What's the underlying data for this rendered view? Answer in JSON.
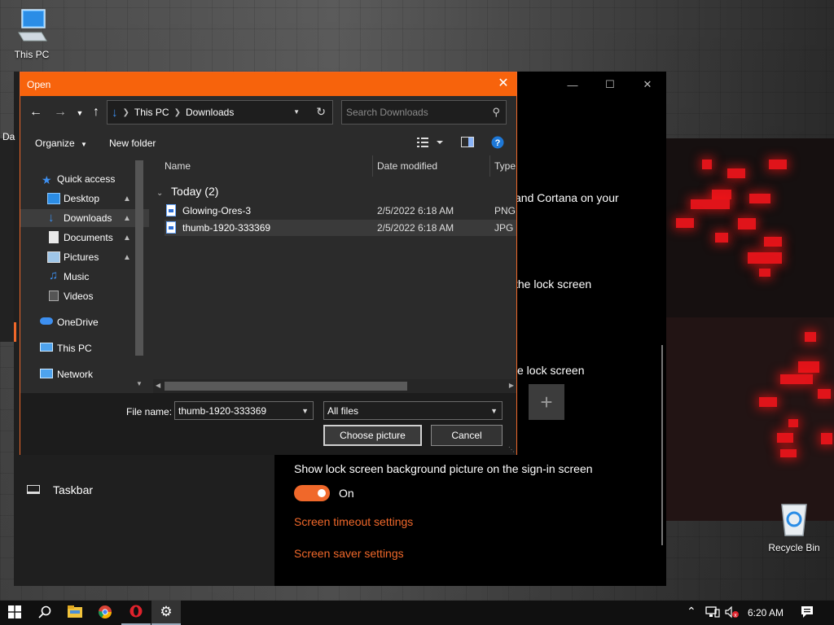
{
  "desktop": {
    "icons": [
      {
        "label": "This PC",
        "icon": "this-pc-icon"
      },
      {
        "label": "Recycle Bin",
        "icon": "recycle-bin-icon"
      }
    ]
  },
  "settings": {
    "left_partial_label": "Da",
    "text_cortana": "and Cortana on your",
    "text_lock_screen_1": "the lock screen",
    "text_lock_screen_2": "e lock screen",
    "add_tile_symbol": "+",
    "taskbar_item": "Taskbar",
    "signin_label": "Show lock screen background picture on the sign-in screen",
    "toggle_state": "On",
    "link_timeout": "Screen timeout settings",
    "link_screensaver": "Screen saver settings",
    "accent_color": "#f0682a"
  },
  "dialog": {
    "title": "Open",
    "address": {
      "root": "This PC",
      "current": "Downloads"
    },
    "search_placeholder": "Search Downloads",
    "toolbar": {
      "organize": "Organize",
      "new_folder": "New folder"
    },
    "nav": [
      {
        "label": "Quick access",
        "icon": "star-icon"
      },
      {
        "label": "Desktop",
        "icon": "desktop-folder-icon",
        "pinned": true
      },
      {
        "label": "Downloads",
        "icon": "downloads-folder-icon",
        "pinned": true,
        "selected": true
      },
      {
        "label": "Documents",
        "icon": "documents-folder-icon",
        "pinned": true
      },
      {
        "label": "Pictures",
        "icon": "pictures-folder-icon",
        "pinned": true
      },
      {
        "label": "Music",
        "icon": "music-folder-icon"
      },
      {
        "label": "Videos",
        "icon": "videos-folder-icon"
      },
      {
        "label": "OneDrive",
        "icon": "onedrive-icon"
      },
      {
        "label": "This PC",
        "icon": "this-pc-icon"
      },
      {
        "label": "Network",
        "icon": "network-icon"
      }
    ],
    "columns": {
      "name": "Name",
      "date": "Date modified",
      "type": "Type"
    },
    "group": "Today (2)",
    "files": [
      {
        "name": "Glowing-Ores-3",
        "date": "2/5/2022 6:18 AM",
        "type": "PNG"
      },
      {
        "name": "thumb-1920-333369",
        "date": "2/5/2022 6:18 AM",
        "type": "JPG F",
        "selected": true
      }
    ],
    "filename_label": "File name:",
    "filename_value": "thumb-1920-333369",
    "filter_value": "All files",
    "choose_button": "Choose picture",
    "cancel_button": "Cancel"
  },
  "taskbar": {
    "clock": "6:20 AM",
    "apps": [
      "windows-start-icon",
      "search-icon",
      "file-explorer-icon",
      "chrome-icon",
      "opera-icon",
      "settings-gear-icon"
    ]
  }
}
